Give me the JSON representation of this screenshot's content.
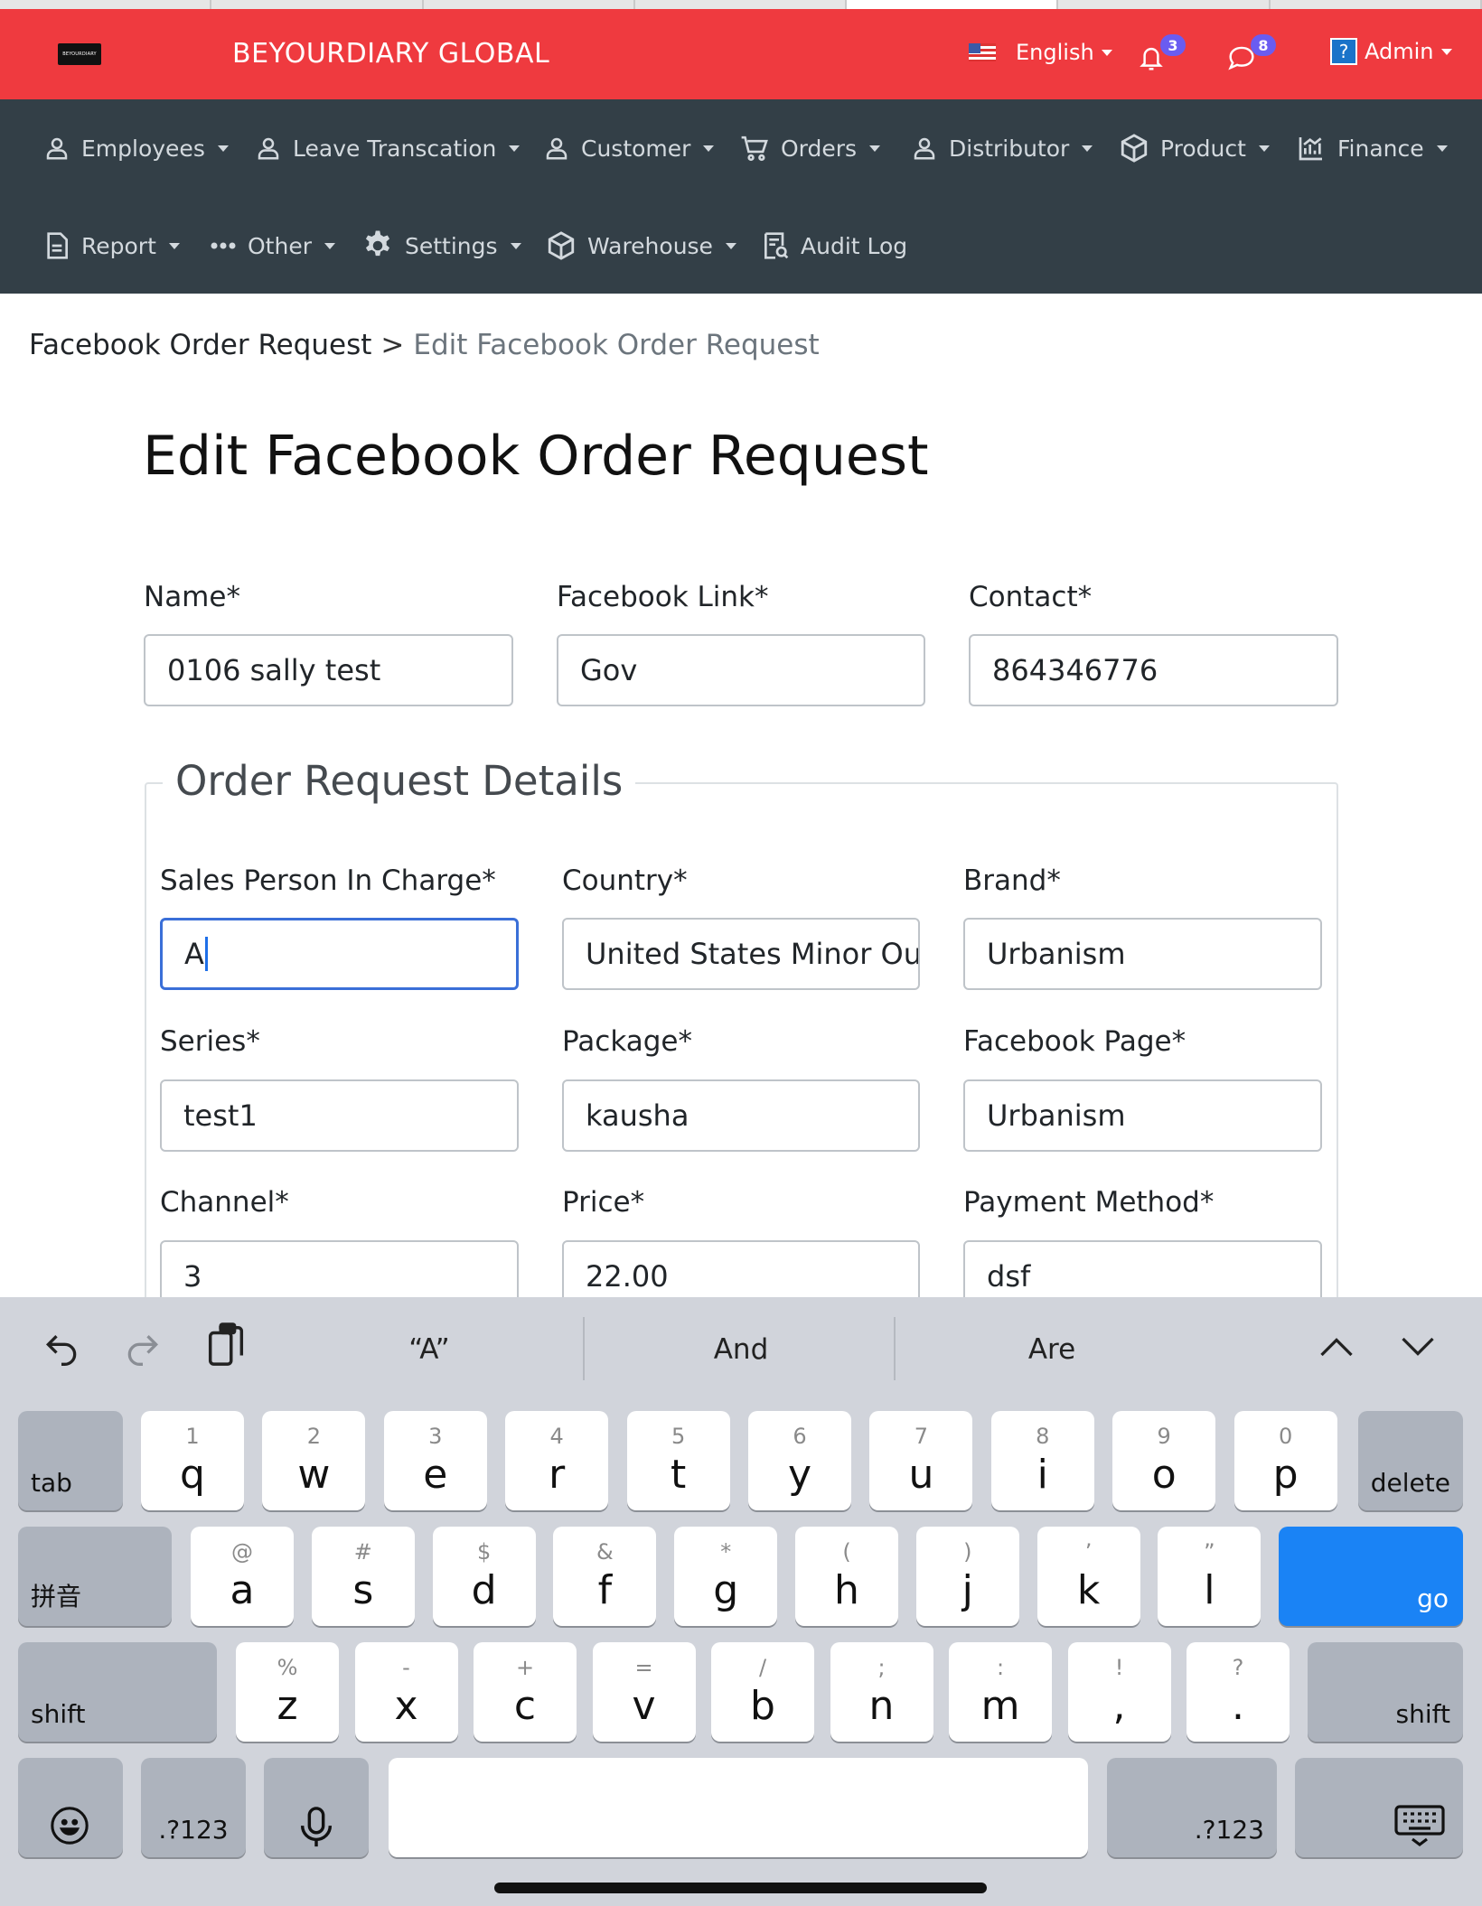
{
  "header": {
    "logo_text": "BEYOURDIARY",
    "brand": "BEYOURDIARY GLOBAL",
    "language": "English",
    "notifications_count": "3",
    "messages_count": "8",
    "help_icon_text": "?",
    "user": "Admin",
    "color": "#ef3a3f"
  },
  "nav": {
    "items": [
      {
        "label": "Employees",
        "icon": "person-icon"
      },
      {
        "label": "Leave Transcation",
        "icon": "person-icon"
      },
      {
        "label": "Customer",
        "icon": "person-icon"
      },
      {
        "label": "Orders",
        "icon": "cart-icon"
      },
      {
        "label": "Distributor",
        "icon": "person-icon"
      },
      {
        "label": "Product",
        "icon": "box-icon"
      },
      {
        "label": "Finance",
        "icon": "chart-icon"
      },
      {
        "label": "Report",
        "icon": "document-icon"
      },
      {
        "label": "Other",
        "icon": "dots-icon"
      },
      {
        "label": "Settings",
        "icon": "gear-icon"
      },
      {
        "label": "Warehouse",
        "icon": "box-icon"
      },
      {
        "label": "Audit Log",
        "icon": "audit-icon"
      }
    ]
  },
  "breadcrumb": {
    "parent": "Facebook Order Request",
    "separator": ">",
    "current": "Edit Facebook Order Request"
  },
  "page": {
    "title": "Edit Facebook Order Request"
  },
  "form": {
    "name": {
      "label": "Name*",
      "value": "0106 sally test"
    },
    "facebook_link": {
      "label": "Facebook Link*",
      "value": "Gov"
    },
    "contact": {
      "label": "Contact*",
      "value": "864346776"
    },
    "details_legend": "Order Request Details",
    "sales_person": {
      "label": "Sales Person In Charge*",
      "value": "A"
    },
    "country": {
      "label": "Country*",
      "value": "United States Minor Outlying Islands"
    },
    "brand": {
      "label": "Brand*",
      "value": "Urbanism"
    },
    "series": {
      "label": "Series*",
      "value": "test1"
    },
    "package": {
      "label": "Package*",
      "value": "kausha"
    },
    "facebook_page": {
      "label": "Facebook Page*",
      "value": "Urbanism"
    },
    "channel": {
      "label": "Channel*",
      "value": "3"
    },
    "price": {
      "label": "Price*",
      "value": "22.00"
    },
    "payment_method": {
      "label": "Payment Method*",
      "value": "dsf"
    }
  },
  "keyboard": {
    "suggestions": [
      "“A”",
      "And",
      "Are"
    ],
    "row1": [
      {
        "main": "q",
        "sub": "1"
      },
      {
        "main": "w",
        "sub": "2"
      },
      {
        "main": "e",
        "sub": "3"
      },
      {
        "main": "r",
        "sub": "4"
      },
      {
        "main": "t",
        "sub": "5"
      },
      {
        "main": "y",
        "sub": "6"
      },
      {
        "main": "u",
        "sub": "7"
      },
      {
        "main": "i",
        "sub": "8"
      },
      {
        "main": "o",
        "sub": "9"
      },
      {
        "main": "p",
        "sub": "0"
      }
    ],
    "row2": [
      {
        "main": "a",
        "sub": "@"
      },
      {
        "main": "s",
        "sub": "#"
      },
      {
        "main": "d",
        "sub": "$"
      },
      {
        "main": "f",
        "sub": "&"
      },
      {
        "main": "g",
        "sub": "*"
      },
      {
        "main": "h",
        "sub": "("
      },
      {
        "main": "j",
        "sub": ")"
      },
      {
        "main": "k",
        "sub": "’"
      },
      {
        "main": "l",
        "sub": "”"
      }
    ],
    "row3": [
      {
        "main": "z",
        "sub": "%"
      },
      {
        "main": "x",
        "sub": "-"
      },
      {
        "main": "c",
        "sub": "+"
      },
      {
        "main": "v",
        "sub": "="
      },
      {
        "main": "b",
        "sub": "/"
      },
      {
        "main": "n",
        "sub": ";"
      },
      {
        "main": "m",
        "sub": ":"
      },
      {
        "main": ",",
        "sub": "!"
      },
      {
        "main": ".",
        "sub": "?"
      }
    ],
    "tab": "tab",
    "delete": "delete",
    "pinyin": "拼音",
    "go": "go",
    "shift": "shift",
    "numbers": ".?123"
  }
}
